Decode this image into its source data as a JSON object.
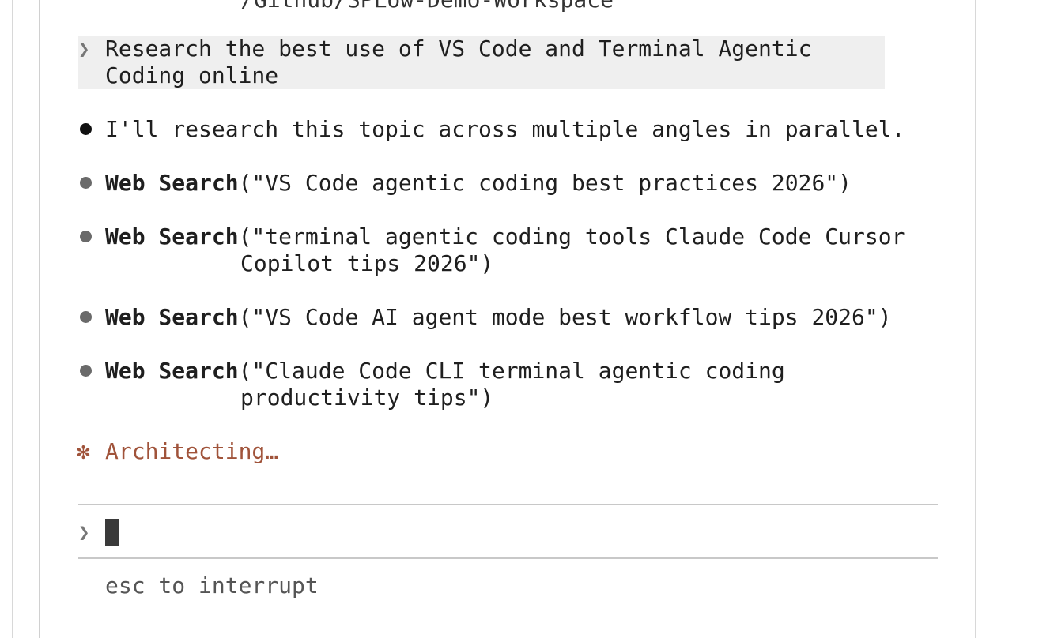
{
  "header": {
    "cwd": "/Github/SPLow-Demo-Workspace"
  },
  "user_prompt": {
    "glyph": "❯",
    "line1": "Research the best use of VS Code and Terminal Agentic",
    "line2": "Coding online"
  },
  "messages": [
    {
      "kind": "text",
      "text": "I'll research this topic across multiple angles in parallel."
    },
    {
      "kind": "tool",
      "tool": "Web Search",
      "line1": "(\"VS Code agentic coding best practices 2026\")",
      "line2": ""
    },
    {
      "kind": "tool",
      "tool": "Web Search",
      "line1": "(\"terminal agentic coding tools Claude Code Cursor",
      "line2": "Copilot tips 2026\")"
    },
    {
      "kind": "tool",
      "tool": "Web Search",
      "line1": "(\"VS Code AI agent mode best workflow tips 2026\")",
      "line2": ""
    },
    {
      "kind": "tool",
      "tool": "Web Search",
      "line1": "(\"Claude Code CLI terminal agentic coding",
      "line2": "productivity tips\")"
    }
  ],
  "status": {
    "icon": "spark-icon",
    "glyph": "✻",
    "text": "Architecting…",
    "color": "#a0533a"
  },
  "input": {
    "glyph": "❯",
    "value": ""
  },
  "footer": {
    "hint": "esc to interrupt"
  }
}
